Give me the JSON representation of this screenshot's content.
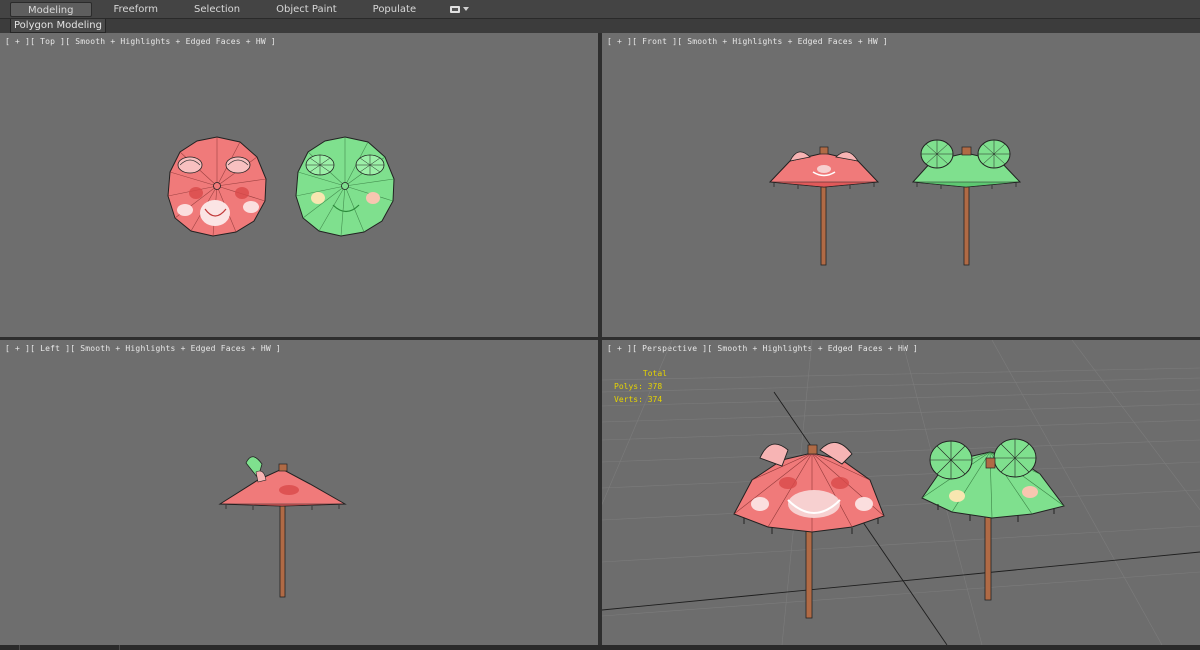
{
  "ribbon": {
    "tabs": [
      {
        "label": "Modeling",
        "active": true
      },
      {
        "label": "Freeform",
        "active": false
      },
      {
        "label": "Selection",
        "active": false
      },
      {
        "label": "Object Paint",
        "active": false
      },
      {
        "label": "Populate",
        "active": false
      }
    ],
    "panel_label": "Polygon Modeling"
  },
  "viewports": {
    "top": {
      "label": "[ + ][ Top ][ Smooth + Highlights + Edged Faces + HW ]"
    },
    "front": {
      "label": "[ + ][ Front ][ Smooth + Highlights + Edged Faces + HW ]"
    },
    "left": {
      "label": "[ + ][ Left ][ Smooth + Highlights + Edged Faces + HW ]"
    },
    "perspective": {
      "label": "[ + ][ Perspective ][ Smooth + Highlights + Edged Faces + HW ]"
    }
  },
  "stats": {
    "header": "Total",
    "polys_label": "Polys:",
    "polys_value": "378",
    "verts_label": "Verts:",
    "verts_value": "374"
  },
  "colors": {
    "viewport_bg": "#6e6e6e",
    "umbrella_pink": "#f07878",
    "umbrella_green": "#78e08a",
    "handle": "#a0603a",
    "stats_text": "#e6d400"
  },
  "icons": {
    "ribbon_toggle": "ribbon-minimize-icon"
  }
}
